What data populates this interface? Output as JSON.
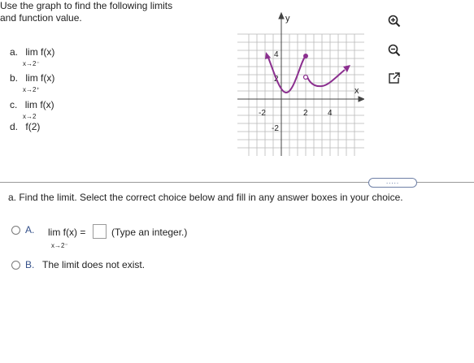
{
  "problem": {
    "intro_line1": "Use the graph to find the following limits",
    "intro_line2": "and function value.",
    "parts": [
      {
        "label": "a.",
        "expr": "lim f(x)",
        "sub": "x→2⁻"
      },
      {
        "label": "b.",
        "expr": "lim f(x)",
        "sub": "x→2⁺"
      },
      {
        "label": "c.",
        "expr": "lim f(x)",
        "sub": "x→2"
      },
      {
        "label": "d.",
        "expr": "f(2)",
        "sub": ""
      }
    ]
  },
  "graph": {
    "x_axis_label": "x",
    "y_axis_label": "y",
    "tick_labels": {
      "y_pos4": "4",
      "y_pos2": "2",
      "y_neg2": "-2",
      "x_neg2": "-2",
      "x_pos2": "2",
      "x_pos4": "4"
    },
    "curve_color": "#8b2f8f"
  },
  "tools": [
    "zoom-in-icon",
    "zoom-out-icon",
    "expand-icon"
  ],
  "more_button": ".....",
  "question": "a. Find the limit. Select the correct choice below and fill in any answer boxes in your choice.",
  "choices": {
    "a": {
      "label": "A.",
      "expr": "lim f(x) =",
      "sub": "x→2⁻",
      "hint": "(Type an integer.)"
    },
    "b": {
      "label": "B.",
      "text": "The limit does not exist."
    }
  }
}
